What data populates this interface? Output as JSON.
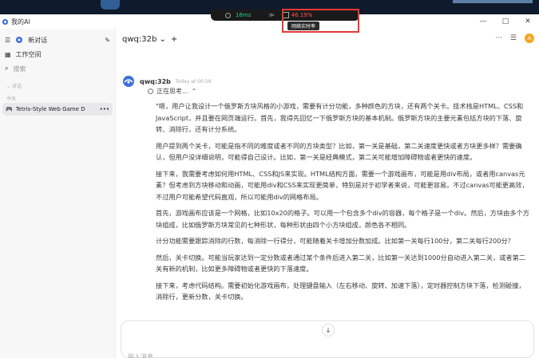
{
  "perf": {
    "ping": "16ms",
    "fps": "46.19%",
    "tooltip": "网络实时率"
  },
  "window": {
    "app_title": "我的AI",
    "controls": [
      "—",
      "□",
      "✕"
    ]
  },
  "sidebar": {
    "new_chat": "新对话",
    "workspace": "工作空间",
    "search": "搜索",
    "section_chats": "对话",
    "section_today": "今天",
    "chat_item": "Tetris-Style Web Game D"
  },
  "header": {
    "model": "qwq:32b",
    "avatar_letter": "A"
  },
  "message": {
    "model": "qwq:32b",
    "time": "Today at 00:58",
    "thinking": "正在思考...",
    "paragraphs": [
      "\"嗯，用户让我设计一个俄罗斯方块风格的小游戏，需要有计分功能，多种颜色的方块，还有两个关卡。技术栈是HTML、CSS和JavaScript，并且要在网页端运行。首先，我得先回忆一下俄罗斯方块的基本机制。俄罗斯方块的主要元素包括方块的下落、旋转、消除行，还有计分系统。",
      "用户提到两个关卡，可能是指不同的难度或者不同的方块类型？比如，第一关是基础，第二关速度更快或者方块更多样？需要确认，但用户没详细说明，可能得自己设计。比如，第一关是经典模式，第二关可能增加障碍物或者更快的速度。",
      "接下来，我需要考虑如何用HTML、CSS和JS来实现。HTML结构方面，需要一个游戏画布，可能是用div布局，或者用canvas元素？但考虑到方块移动和动画，可能用div和CSS来实现更简单，特别是对于初学者来说，可能更容易。不过canvas可能更高效，不过用户可能希望代码直观，所以可能用div的网格布局。",
      "首先，游戏画布应该是一个网格，比如10x20的格子。可以用一个包含多个div的容器，每个格子是一个div。然后，方块由多个方块组成，比如俄罗斯方块常见的七种形状，每种形状由四个小方块组成，颜色各不相同。",
      "计分功能需要跟踪消除的行数，每消除一行得分，可能随着关卡增加分数加成。比如第一关每行100分，第二关每行200分？",
      "然后，关卡切换。可能当玩家达到一定分数或者通过某个条件后进入第二关，比如第一关达到1000分自动进入第二关，或者第二关有新的机制，比如更多障碍物或者更快的下落速度。",
      "接下来，考虑代码结构。需要初始化游戏画布，处理键盘输入（左右移动、旋转、加速下落），定时器控制方块下落，检测碰撞，消除行，更新分数，关卡切换。"
    ]
  },
  "input": {
    "placeholder": "输入消息"
  }
}
